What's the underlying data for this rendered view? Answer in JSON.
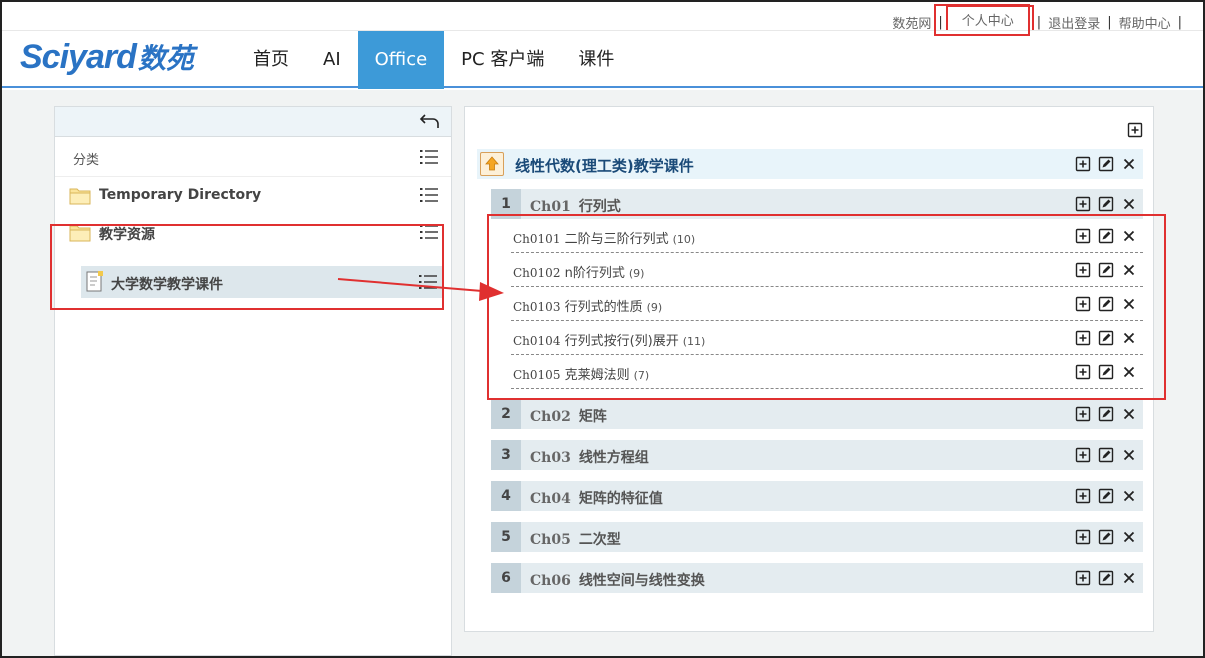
{
  "top_links": {
    "site": "数苑网",
    "personal": "个人中心",
    "logout": "退出登录",
    "help": "帮助中心",
    "sep": "|"
  },
  "logo": {
    "en": "Sciyard",
    "cn": "数苑"
  },
  "nav": [
    "首页",
    "AI",
    "Office",
    "PC 客户端",
    "课件"
  ],
  "nav_active": "Office",
  "left": {
    "category_label": "分类",
    "folders": [
      "Temporary Directory",
      "教学资源"
    ],
    "sub_item": "大学数学教学课件"
  },
  "right": {
    "course_title": "线性代数(理工类)教学课件",
    "chapters": [
      {
        "num": "1",
        "code": "Ch01",
        "title": "行列式"
      },
      {
        "num": "2",
        "code": "Ch02",
        "title": "矩阵"
      },
      {
        "num": "3",
        "code": "Ch03",
        "title": "线性方程组"
      },
      {
        "num": "4",
        "code": "Ch04",
        "title": "矩阵的特征值"
      },
      {
        "num": "5",
        "code": "Ch05",
        "title": "二次型"
      },
      {
        "num": "6",
        "code": "Ch06",
        "title": "线性空间与线性变换"
      }
    ],
    "sections": [
      {
        "code": "Ch0101",
        "title": "二阶与三阶行列式",
        "count": "(10)"
      },
      {
        "code": "Ch0102",
        "title": "n阶行列式",
        "count": "(9)"
      },
      {
        "code": "Ch0103",
        "title": "行列式的性质",
        "count": "(9)"
      },
      {
        "code": "Ch0104",
        "title": "行列式按行(列)展开",
        "count": "(11)"
      },
      {
        "code": "Ch0105",
        "title": "克莱姆法则",
        "count": "(7)"
      }
    ]
  },
  "colors": {
    "accent": "#3d9ad8",
    "annotation": "#e03030",
    "logo": "#2a73c4"
  }
}
